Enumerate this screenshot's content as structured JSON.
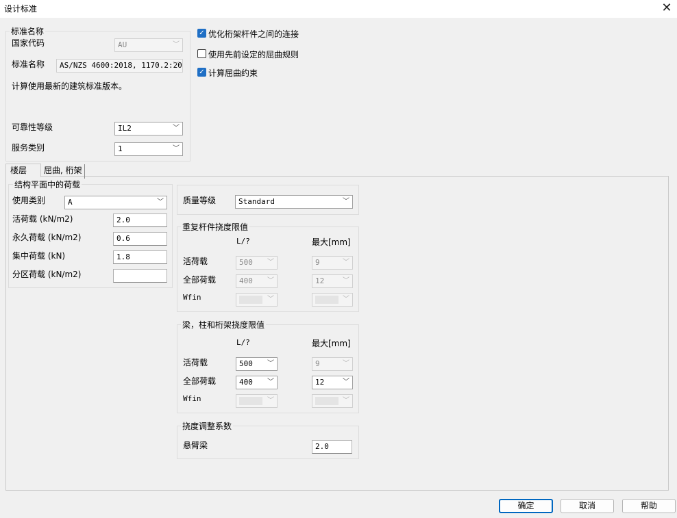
{
  "window": {
    "title": "设计标准",
    "close_glyph": "✕"
  },
  "standard": {
    "group_title": "标准名称",
    "country_label": "国家代码",
    "country_value": "AU",
    "standard_label": "标准名称",
    "standard_value": "AS/NZS 4600:2018, 1170.2:20",
    "note": "计算使用最新的建筑标准版本。",
    "reliability_label": "可靠性等级",
    "reliability_value": "IL2",
    "service_label": "服务类别",
    "service_value": "1"
  },
  "options": {
    "optimize_truss": {
      "label": "优化桁架杆件之间的连接",
      "checked": true
    },
    "use_previous_buckling": {
      "label": "使用先前设定的屈曲规则",
      "checked": false
    },
    "compute_buckling": {
      "label": "计算屈曲约束",
      "checked": true
    }
  },
  "tabs": [
    {
      "label": "楼层",
      "active": true
    },
    {
      "label": "屈曲, 桁架",
      "active": false
    }
  ],
  "loads": {
    "group_title": "结构平面中的荷载",
    "usage_label": "使用类别",
    "usage_value": "A",
    "live_label": "活荷载 (kN/m2)",
    "live_value": "2.0",
    "permanent_label": "永久荷载 (kN/m2)",
    "permanent_value": "0.6",
    "concentrated_label": "集中荷载 (kN)",
    "concentrated_value": "1.8",
    "partition_label": "分区荷载 (kN/m2)",
    "partition_value": ""
  },
  "quality": {
    "label": "质量等级",
    "value": "Standard"
  },
  "repeated_deflection": {
    "group_title": "重复杆件挠度限值",
    "col_l": "L/?",
    "col_max": "最大[mm]",
    "live_label": "活荷载",
    "live_l": "500",
    "live_max": "9",
    "total_label": "全部荷载",
    "total_l": "400",
    "total_max": "12",
    "wfin_label": "Wfin"
  },
  "beam_deflection": {
    "group_title": "梁，柱和桁架挠度限值",
    "col_l": "L/?",
    "col_max": "最大[mm]",
    "live_label": "活荷载",
    "live_l": "500",
    "live_max": "9",
    "total_label": "全部荷载",
    "total_l": "400",
    "total_max": "12",
    "wfin_label": "Wfin"
  },
  "deflection_factor": {
    "group_title": "挠度调整系数",
    "cantilever_label": "悬臂梁",
    "cantilever_value": "2.0"
  },
  "buttons": {
    "ok": "确定",
    "cancel": "取消",
    "help": "帮助"
  },
  "icons": {
    "dropdown": "chevron-down-icon",
    "check": "checkmark-icon",
    "close": "close-icon"
  },
  "colors": {
    "accent": "#0067c0",
    "checkbox": "#1f6fc5",
    "background": "#f0f0f0"
  }
}
